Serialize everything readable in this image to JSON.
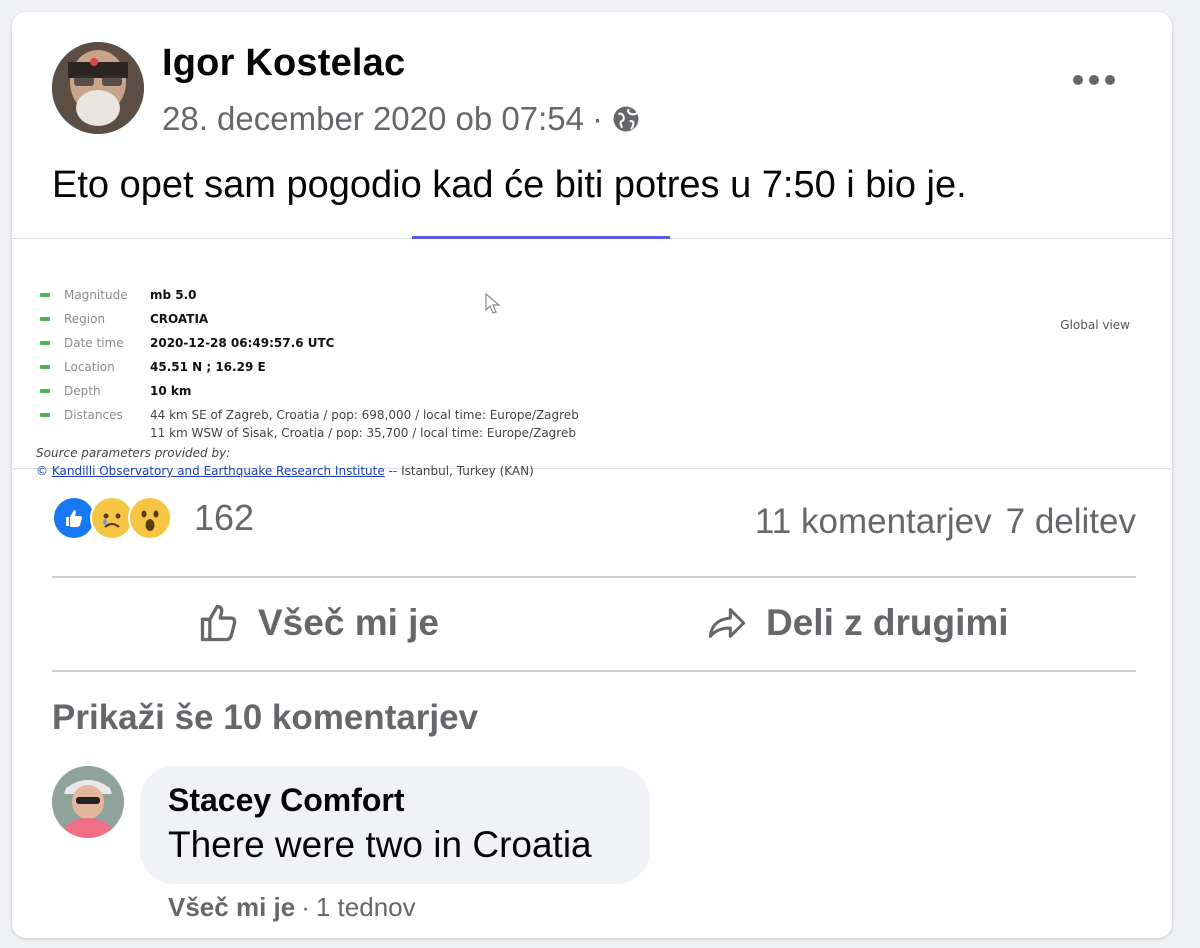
{
  "post": {
    "author": "Igor Kostelac",
    "timestamp": "28. december 2020 ob 07:54",
    "meta_separator": "·",
    "privacy_icon": "globe-icon",
    "text": "Eto opet sam pogodio kad će biti potres u 7:50 i bio je."
  },
  "embed": {
    "rows": [
      {
        "label": "Magnitude",
        "value": "mb 5.0"
      },
      {
        "label": "Region",
        "value": "CROATIA"
      },
      {
        "label": "Date time",
        "value": "2020-12-28 06:49:57.6 UTC"
      },
      {
        "label": "Location",
        "value": "45.51 N ; 16.29 E"
      },
      {
        "label": "Depth",
        "value": "10 km"
      },
      {
        "label": "Distances",
        "value": "44 km SE of Zagreb, Croatia / pop: 698,000 / local time: Europe/Zagreb"
      }
    ],
    "distance_line2": "11 km WSW of Sisak, Croatia / pop: 35,700 / local time: Europe/Zagreb",
    "source_label": "Source parameters provided by:",
    "source_link": "Kandilli Observatory and Earthquake Research Institute",
    "source_rest": "-- Istanbul, Turkey (KAN)",
    "global_view": "Global view"
  },
  "reactions": {
    "icons": [
      "like-icon",
      "sad-icon",
      "wow-icon"
    ],
    "count": "162",
    "comments": "11 komentarjev",
    "shares": "7 delitev"
  },
  "actions": {
    "like": "Všeč mi je",
    "share": "Deli z drugimi"
  },
  "comments": {
    "show_more": "Prikaži še 10 komentarjev",
    "items": [
      {
        "name": "Stacey Comfort",
        "text": "There were two in Croatia",
        "like": "Všeč mi je",
        "separator": "·",
        "time": "1 tednov"
      }
    ]
  },
  "colors": {
    "accent": "#1877f2",
    "secondary_text": "#65676b",
    "bubble": "#f0f2f5"
  }
}
